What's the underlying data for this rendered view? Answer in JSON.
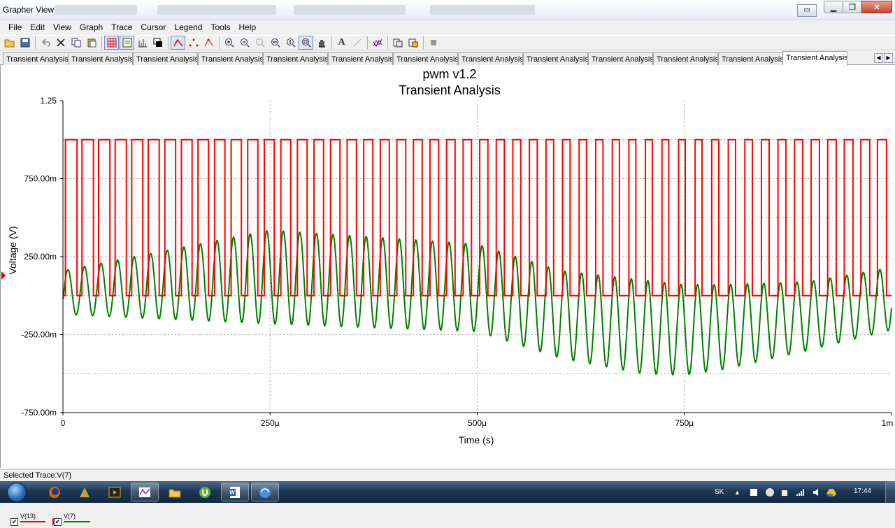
{
  "window": {
    "title": "Grapher View",
    "buttons": {
      "minimize": "▁",
      "maximize": "❐",
      "close": "✕"
    }
  },
  "menu": [
    "File",
    "Edit",
    "View",
    "Graph",
    "Trace",
    "Cursor",
    "Legend",
    "Tools",
    "Help"
  ],
  "toolbar": {
    "icons": [
      "open-icon",
      "save-icon",
      "undo-icon",
      "cut-icon",
      "copy-icon",
      "paste-icon",
      "grid-icon",
      "legend-icon",
      "histogram-icon",
      "overlay-icon",
      "trace-line-icon",
      "trace-dots-icon",
      "trace-steps-icon",
      "zoom-in-icon",
      "zoom-out-icon",
      "zoom-fit-icon",
      "zoom-x-icon",
      "zoom-y-icon",
      "zoom-area-icon",
      "pan-icon",
      "text-icon",
      "cursor-dim-icon",
      "merge-traces-icon",
      "export-icon",
      "export-data-icon",
      "stop-icon"
    ],
    "text_icon_label": "A"
  },
  "tabs": [
    "Transient Analysis",
    "Transient Analysis",
    "Transient Analysis",
    "Transient Analysis",
    "Transient Analysis",
    "Transient Analysis",
    "Transient Analysis",
    "Transient Analysis",
    "Transient Analysis",
    "Transient Analysis",
    "Transient Analysis",
    "Transient Analysis",
    "Transient Analysis"
  ],
  "active_tab": 12,
  "chart_data": {
    "type": "line",
    "title": "pwm v1.2",
    "subtitle": "Transient Analysis",
    "xlabel": "Time (s)",
    "ylabel": "Voltage (V)",
    "x_unit": "s",
    "xlim": [
      0,
      0.001
    ],
    "ylim": [
      -0.75,
      1.25
    ],
    "x_tick_labels": [
      "0",
      "250µ",
      "500µ",
      "750µ",
      "1m"
    ],
    "x_ticks": [
      0,
      0.00025,
      0.0005,
      0.00075,
      0.001
    ],
    "y_tick_labels": [
      "1.25",
      "750.00m",
      "250.00m",
      "-250.00m",
      "-750.00m"
    ],
    "y_ticks": [
      1.25,
      0.75,
      0.25,
      -0.25,
      -0.75
    ],
    "grid": true,
    "series": [
      {
        "name": "V(13)",
        "color": "#ff0000",
        "kind": "pwm-square",
        "high": 1.0,
        "low": 0.0,
        "period": 2e-05,
        "duty_start": 0.7,
        "duty_end": 0.4,
        "note_values": "square wave between 0 V and 1 V, ~50 cycles over 1 ms, duty decreasing toward 750µ then increasing"
      },
      {
        "name": "V(7)",
        "color": "#008000",
        "kind": "oscillation",
        "period": 2e-05,
        "center_points": [
          [
            0,
            0.02
          ],
          [
            0.00025,
            0.12
          ],
          [
            0.0005,
            0.05
          ],
          [
            0.0006,
            -0.12
          ],
          [
            0.0007,
            -0.2
          ],
          [
            0.00075,
            -0.22
          ],
          [
            0.0008,
            -0.2
          ],
          [
            0.0009,
            -0.13
          ],
          [
            0.001,
            -0.02
          ]
        ],
        "amplitude_points": [
          [
            0,
            0.14
          ],
          [
            0.00025,
            0.3
          ],
          [
            0.0005,
            0.28
          ],
          [
            0.0006,
            0.28
          ],
          [
            0.0007,
            0.3
          ],
          [
            0.00075,
            0.29
          ],
          [
            0.0008,
            0.27
          ],
          [
            0.0009,
            0.22
          ],
          [
            0.001,
            0.2
          ]
        ]
      }
    ]
  },
  "legend": [
    {
      "label": "V(13)",
      "checked": true,
      "color": "#ff0000"
    },
    {
      "label": "V(7)",
      "checked": true,
      "color": "#008000"
    }
  ],
  "status": "Selected Trace:V(7)",
  "taskbar": {
    "apps": [
      "firefox-icon",
      "app-icon",
      "media-icon",
      "grapher-icon",
      "explorer-icon",
      "utorrent-icon",
      "word-icon",
      "network-icon"
    ],
    "lang": "SK",
    "clock": "17:44"
  }
}
